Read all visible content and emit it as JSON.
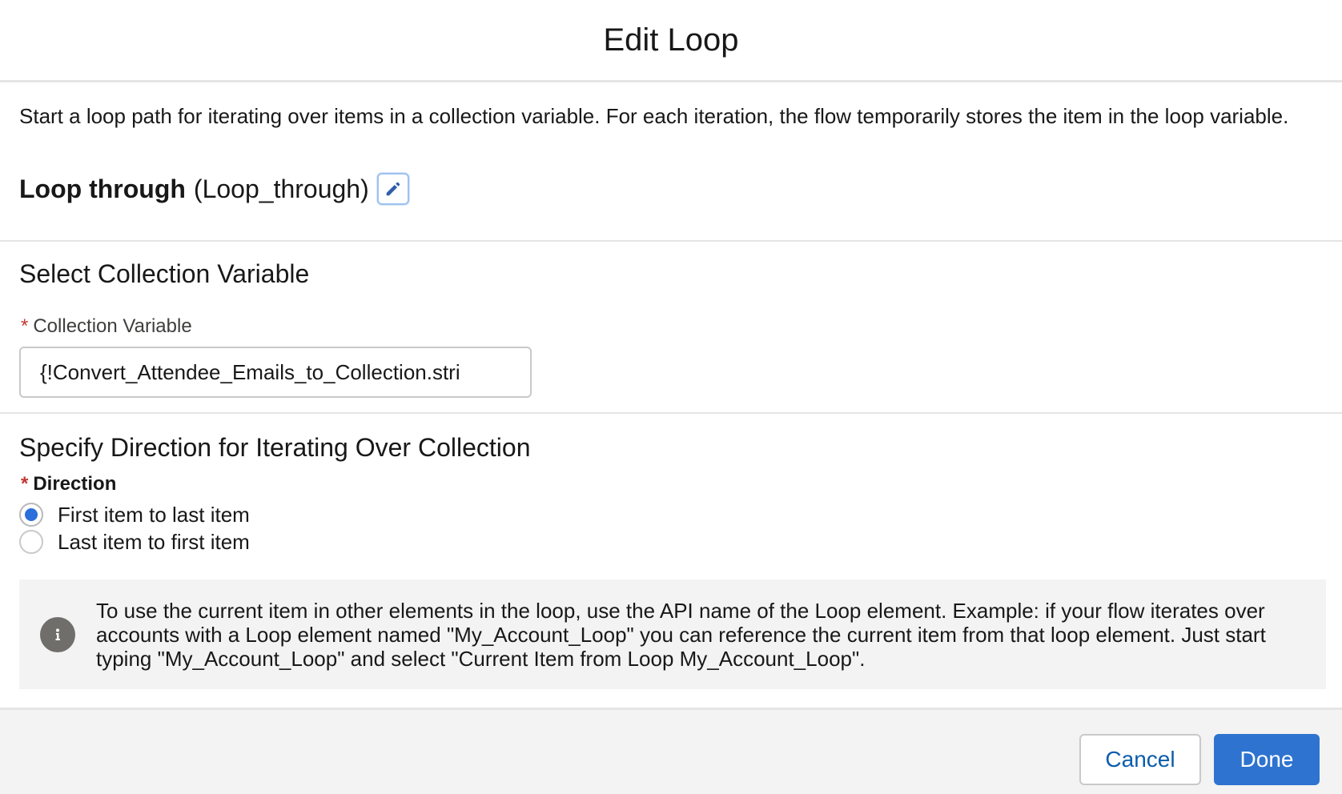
{
  "modal": {
    "title": "Edit Loop",
    "description": "Start a loop path for iterating over items in a collection variable. For each iteration, the flow temporarily stores the item in the loop variable.",
    "element_label": "Loop through",
    "element_api_name": "(Loop_through)"
  },
  "collection_section": {
    "title": "Select Collection Variable",
    "field_label": "Collection Variable",
    "required_marker": "*",
    "field_value": "{!Convert_Attendee_Emails_to_Collection.stri"
  },
  "direction_section": {
    "title": "Specify Direction for Iterating Over Collection",
    "field_label": "Direction",
    "required_marker": "*",
    "options": [
      {
        "label": "First item to last item",
        "selected": true
      },
      {
        "label": "Last item to first item",
        "selected": false
      }
    ]
  },
  "info": {
    "icon": "info-icon",
    "text": "To use the current item in other elements in the loop, use the API name of the Loop element. Example: if your flow iterates over accounts with a Loop element named \"My_Account_Loop\" you can reference the current item from that loop element. Just start typing \"My_Account_Loop\" and select \"Current Item from Loop My_Account_Loop\"."
  },
  "footer": {
    "cancel_label": "Cancel",
    "done_label": "Done"
  },
  "colors": {
    "brand": "#2e73d0",
    "required": "#c23934",
    "link": "#0b5cab"
  }
}
